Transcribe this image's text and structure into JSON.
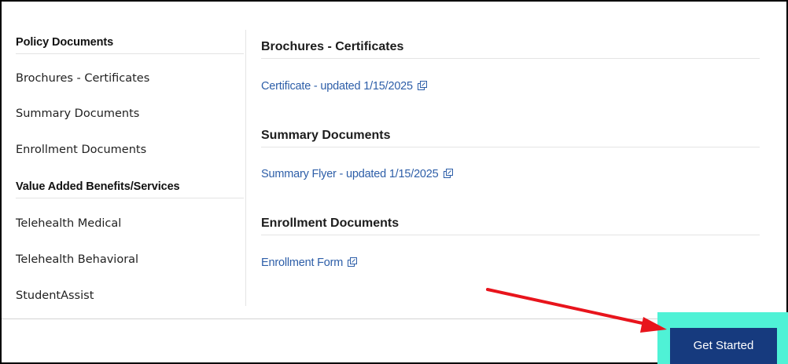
{
  "sidebar": {
    "groups": [
      {
        "heading": "Policy Documents",
        "items": [
          "Brochures - Certificates",
          "Summary Documents",
          "Enrollment Documents"
        ]
      },
      {
        "heading": "Value Added Benefits/Services",
        "items": [
          "Telehealth Medical",
          "Telehealth Behavioral",
          "StudentAssist"
        ]
      }
    ]
  },
  "main": {
    "sections": [
      {
        "heading": "Brochures - Certificates",
        "link": "Certificate - updated 1/15/2025",
        "icon": "external-link-icon"
      },
      {
        "heading": "Summary Documents",
        "link": "Summary Flyer - updated 1/15/2025",
        "icon": "external-link-icon"
      },
      {
        "heading": "Enrollment Documents",
        "link": "Enrollment Form",
        "icon": "external-link-icon"
      }
    ]
  },
  "footer": {
    "cta_label": "Get Started"
  },
  "colors": {
    "link": "#2d5ea8",
    "button": "#163a7e",
    "highlight": "#4ff2d6",
    "arrow": "#e8141c"
  }
}
